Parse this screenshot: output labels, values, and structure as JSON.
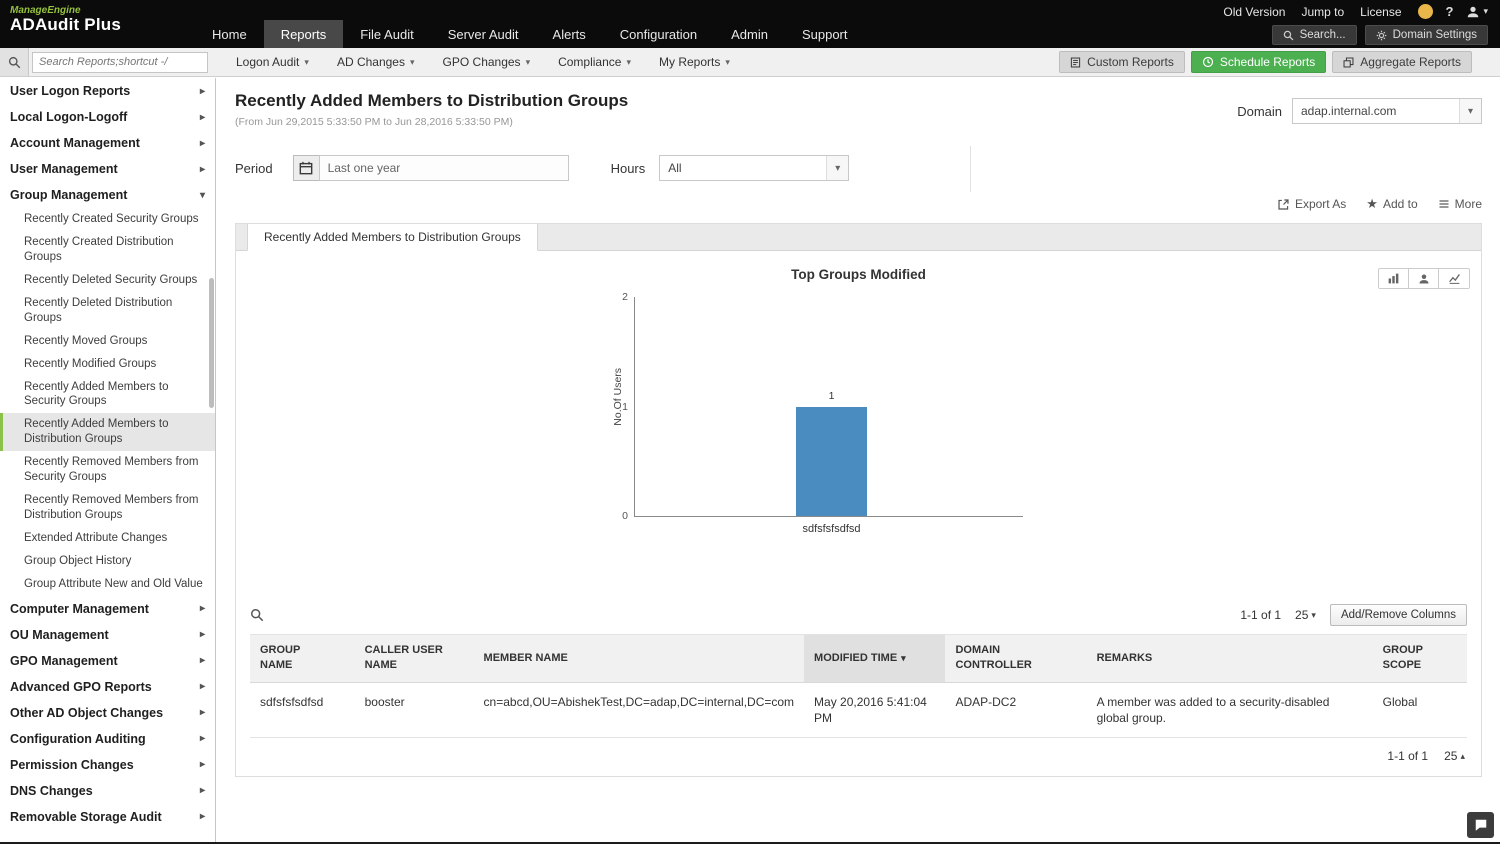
{
  "topbar": {
    "brand_line1": "ManageEngine",
    "brand_line2": "ADAudit Plus",
    "nav": [
      "Home",
      "Reports",
      "File Audit",
      "Server Audit",
      "Alerts",
      "Configuration",
      "Admin",
      "Support"
    ],
    "utility": [
      "Old Version",
      "Jump to",
      "License"
    ],
    "search_label": "Search...",
    "domain_settings_label": "Domain Settings"
  },
  "toolbar": {
    "search_placeholder": "Search Reports;shortcut -/",
    "menus": [
      "Logon Audit",
      "AD Changes",
      "GPO Changes",
      "Compliance",
      "My Reports"
    ],
    "custom_reports": "Custom Reports",
    "schedule_reports": "Schedule Reports",
    "aggregate_reports": "Aggregate Reports"
  },
  "sidebar": {
    "items_before": [
      "User Logon Reports",
      "Local Logon-Logoff",
      "Account Management",
      "User Management"
    ],
    "group_management_label": "Group Management",
    "group_children": [
      "Recently Created Security Groups",
      "Recently Created Distribution Groups",
      "Recently Deleted Security Groups",
      "Recently Deleted Distribution Groups",
      "Recently Moved Groups",
      "Recently Modified Groups",
      "Recently Added Members to Security Groups",
      "Recently Added Members to Distribution Groups",
      "Recently Removed Members from Security Groups",
      "Recently Removed Members from Distribution Groups",
      "Extended Attribute Changes",
      "Group Object History",
      "Group Attribute New and Old Value"
    ],
    "selected_child": "Recently Added Members to Distribution Groups",
    "items_after": [
      "Computer Management",
      "OU Management",
      "GPO Management",
      "Advanced GPO Reports",
      "Other AD Object Changes",
      "Configuration Auditing",
      "Permission Changes",
      "DNS Changes",
      "Removable Storage Audit"
    ]
  },
  "page": {
    "title": "Recently Added Members to Distribution Groups",
    "date_range": "(From Jun 29,2015 5:33:50 PM to Jun 28,2016 5:33:50 PM)",
    "domain_label": "Domain",
    "domain_value": "adap.internal.com",
    "period_label": "Period",
    "period_value": "Last one year",
    "hours_label": "Hours",
    "hours_value": "All",
    "export_as_label": "Export As",
    "add_to_label": "Add to",
    "more_label": "More",
    "tab_label": "Recently Added Members to Distribution Groups"
  },
  "chart_data": {
    "type": "bar",
    "title": "Top Groups Modified",
    "ylabel": "No.Of Users",
    "xlabel": "",
    "categories": [
      "sdfsfsfsdfsd"
    ],
    "values": [
      1
    ],
    "ylim": [
      0,
      2
    ],
    "yticks": [
      0,
      1,
      2
    ],
    "bar_color": "#4a8cbf",
    "grid": false,
    "legend_position": "none"
  },
  "table": {
    "pagination": "1-1 of 1",
    "page_size": "25",
    "add_remove_columns_label": "Add/Remove Columns",
    "headers": [
      "GROUP NAME",
      "CALLER USER NAME",
      "MEMBER NAME",
      "MODIFIED TIME",
      "DOMAIN CONTROLLER",
      "REMARKS",
      "GROUP SCOPE"
    ],
    "sorted_by": "MODIFIED TIME",
    "sort_direction": "desc",
    "rows": [
      {
        "group_name": "sdfsfsfsdfsd",
        "caller_user_name": "booster",
        "member_name": "cn=abcd,OU=AbishekTest,DC=adap,DC=internal,DC=com",
        "modified_time": "May 20,2016 5:41:04 PM",
        "domain_controller": "ADAP-DC2",
        "remarks": "A member was added to a security-disabled global group.",
        "group_scope": "Global"
      }
    ],
    "pagination_bottom": "1-1 of 1",
    "page_size_bottom": "25"
  }
}
